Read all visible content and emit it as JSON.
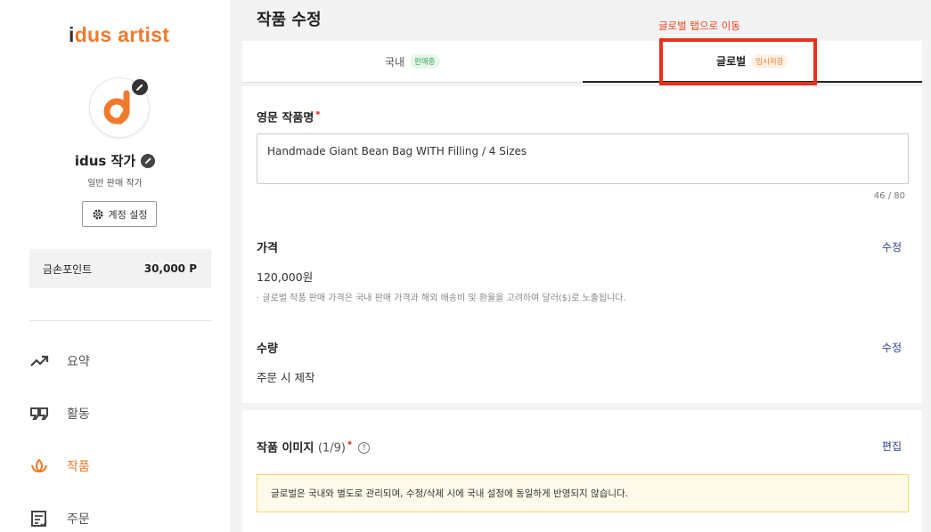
{
  "sidebar": {
    "logo_i": "i",
    "logo_rest": "dus artist",
    "artist_name": "idus 작가",
    "artist_type": "일반 판매 작가",
    "account_settings": "계정 설정",
    "points_label": "금손포인트",
    "points_value": "30,000 P",
    "nav": [
      {
        "label": "요약",
        "icon": "trend-up-icon"
      },
      {
        "label": "활동",
        "icon": "quote-icon"
      },
      {
        "label": "작품",
        "icon": "leaf-icon",
        "active": true
      },
      {
        "label": "주문",
        "icon": "receipt-icon"
      }
    ]
  },
  "header": {
    "title": "작품 수정"
  },
  "tabs": [
    {
      "label": "국내",
      "badge": "판매중"
    },
    {
      "label": "글로벌",
      "badge": "임시저장",
      "active": true
    }
  ],
  "annotation": {
    "text": "글로벌 탭으로 이동"
  },
  "form": {
    "title_label": "영문 작품명",
    "title_value": "Handmade Giant Bean Bag WITH Filling / 4 Sizes",
    "title_counter": "46 / 80",
    "price_label": "가격",
    "price_edit": "수정",
    "price_value": "120,000원",
    "price_note": "· 글로벌 작품 판매 가격은 국내 판매 가격과 해외 배송비 및 환율을 고려하여 달러($)로 노출됩니다.",
    "qty_label": "수량",
    "qty_edit": "수정",
    "qty_value": "주문 시 제작",
    "image_label": "작품 이미지",
    "image_count": "(1/9)",
    "image_edit": "편집",
    "image_notice": "글로벌은 국내와 별도로 관리되며, 수정/삭제 시에 국내 설정에 동일하게 반영되지 않습니다."
  },
  "colors": {
    "accent": "#ef7a2b",
    "link": "#2d3d8a",
    "annotation": "#e8301c"
  }
}
